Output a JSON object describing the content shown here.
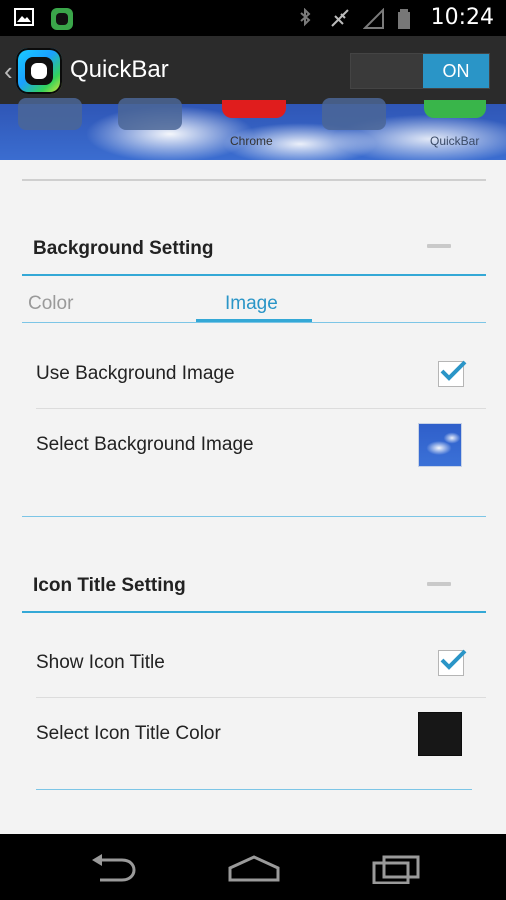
{
  "status_bar": {
    "time": "10:24",
    "icons": [
      "image-icon",
      "app-notification-icon",
      "bluetooth-icon",
      "signal-off-icon",
      "cellular-empty-icon",
      "battery-icon"
    ]
  },
  "action_bar": {
    "title": "QuickBar",
    "toggle_label": "ON",
    "accent_color": "#2A95C7"
  },
  "preview": {
    "labels": [
      "Chrome",
      "QuickBar"
    ]
  },
  "background_setting": {
    "title": "Background Setting",
    "tabs": [
      {
        "label": "Color",
        "selected": false
      },
      {
        "label": "Image",
        "selected": true
      }
    ],
    "rows": [
      {
        "label": "Use Background Image",
        "control": "checkbox",
        "checked": true
      },
      {
        "label": "Select Background Image",
        "control": "image-thumbnail"
      }
    ]
  },
  "icon_title_setting": {
    "title": "Icon Title Setting",
    "rows": [
      {
        "label": "Show Icon Title",
        "control": "checkbox",
        "checked": true
      },
      {
        "label": "Select Icon Title Color",
        "control": "color-swatch",
        "color": "#171717"
      }
    ]
  },
  "nav_bar": {
    "icons": [
      "back-icon",
      "home-icon",
      "recents-icon"
    ]
  }
}
